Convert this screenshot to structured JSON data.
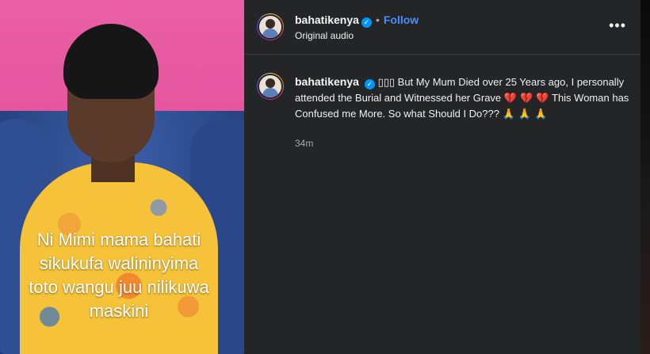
{
  "post": {
    "username": "bahatikenya",
    "follow_label": "Follow",
    "separator": "•",
    "audio_label": "Original audio",
    "more_label": "•••"
  },
  "video": {
    "caption_lines": [
      "Ni Mimi mama bahati",
      "sikukufa walininyima",
      "toto wangu juu nilikuwa",
      "maskini"
    ]
  },
  "comment": {
    "username": "bahatikenya",
    "prefix": "▯▯▯",
    "text": "But My Mum Died over 25 Years ago, I personally attended the Burial and Witnessed her Grave",
    "hearts": "💔 💔 💔",
    "text2": "This Woman has Confused me More. So what Should I Do???",
    "emojis": "🙏 🙏 🙏",
    "timestamp": "34m"
  },
  "icons": {
    "verified": "verified-badge-icon",
    "more": "more-options-icon"
  },
  "colors": {
    "panel_bg": "#242527",
    "follow": "#4a8cff",
    "verified": "#0095f6"
  }
}
